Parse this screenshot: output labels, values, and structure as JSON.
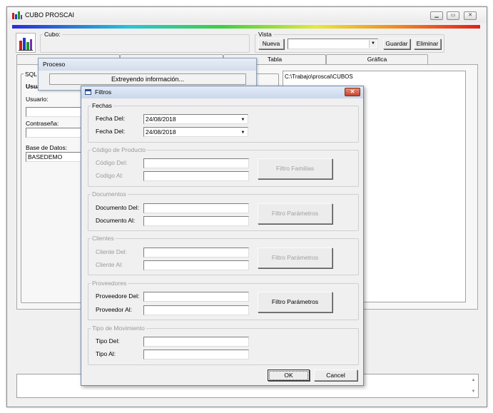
{
  "main_window": {
    "title": "CUBO PROSCAI",
    "cubo_label": "Cubo:",
    "vista_label": "Vista",
    "nueva_label": "Nueva",
    "guardar_label": "Guardar",
    "eliminar_label": "Eliminar",
    "vista_value": "",
    "tabs": [
      {
        "label": ""
      },
      {
        "label": ""
      },
      {
        "label": "Tabla"
      },
      {
        "label": "Gráfica"
      }
    ],
    "sql_group": "SQL",
    "usuario_heading": "Usua",
    "usuario_label": "Usuario:",
    "usuario_value": "",
    "contrasena_label": "Contraseña:",
    "contrasena_value": "",
    "base_label": "Base de Datos:",
    "base_value": "BASEDEMO",
    "path_text": "C:\\Trabajo\\proscai\\CUBOS",
    "status_text": ""
  },
  "proceso_window": {
    "title": "Proceso",
    "message": "Extreyendo información..."
  },
  "filtros_dialog": {
    "title": "Filtros",
    "fechas": {
      "title": "Fechas",
      "fecha_del_label": "Fecha Del:",
      "fecha_del_value": "24/08/2018",
      "fecha_al_label": "Fecha Del:",
      "fecha_al_value": "24/08/2018"
    },
    "producto": {
      "title": "Código de Producto",
      "del_label": "Código Del:",
      "al_label": "Codigo Al:",
      "del_value": "",
      "al_value": "",
      "button": "Filtro Familias"
    },
    "documentos": {
      "title": "Documentos",
      "del_label": "Documento Del:",
      "al_label": "Documento Al:",
      "del_value": "",
      "al_value": "",
      "button": "Filtro Parámetros"
    },
    "clientes": {
      "title": "Clientes",
      "del_label": "Cliente Del:",
      "al_label": "Cliente Al:",
      "del_value": "",
      "al_value": "",
      "button": "Filtro Parámetros"
    },
    "proveedores": {
      "title": "Proveedores",
      "del_label": "Proveedore Del:",
      "al_label": "Proveedor Al:",
      "del_value": "",
      "al_value": "",
      "button": "Filtro Parámetros"
    },
    "movimiento": {
      "title": "Tipo de Movimiento",
      "del_label": "Tipo Del:",
      "al_label": "Tipo Al:",
      "del_value": "",
      "al_value": ""
    },
    "ok_label": "OK",
    "cancel_label": "Cancel"
  },
  "colors": {
    "accent_close": "#c8442e",
    "dialog_caption": "#d3dff0",
    "window_bg": "#f0f0f0"
  },
  "icons": [
    "chart-bars-icon",
    "minimize-icon",
    "maximize-icon",
    "close-icon",
    "filter-window-icon",
    "combo-arrow-icon",
    "scroll-up-icon",
    "scroll-down-icon"
  ]
}
